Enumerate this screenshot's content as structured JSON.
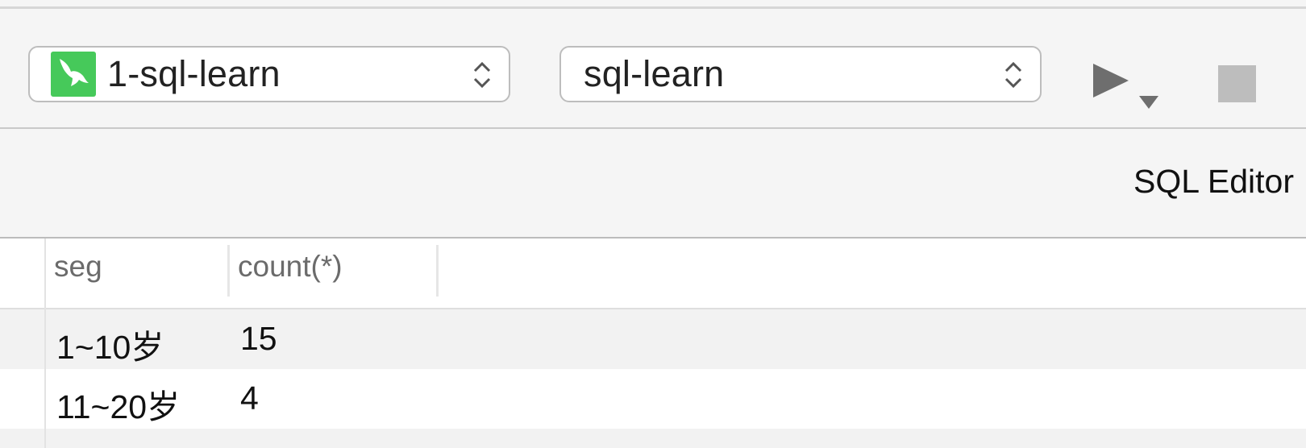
{
  "toolbar": {
    "connection": {
      "label": "1-sql-learn",
      "icon": "mysql-dolphin-icon",
      "icon_color": "#46c95a"
    },
    "database": {
      "label": "sql-learn"
    },
    "run_icon": "play-icon",
    "stop_icon": "stop-icon"
  },
  "editor": {
    "title": "SQL Editor"
  },
  "results": {
    "columns": [
      "seg",
      "count(*)"
    ],
    "rows": [
      {
        "seg": "1~10岁",
        "count": "15"
      },
      {
        "seg": "11~20岁",
        "count": "4"
      }
    ]
  }
}
